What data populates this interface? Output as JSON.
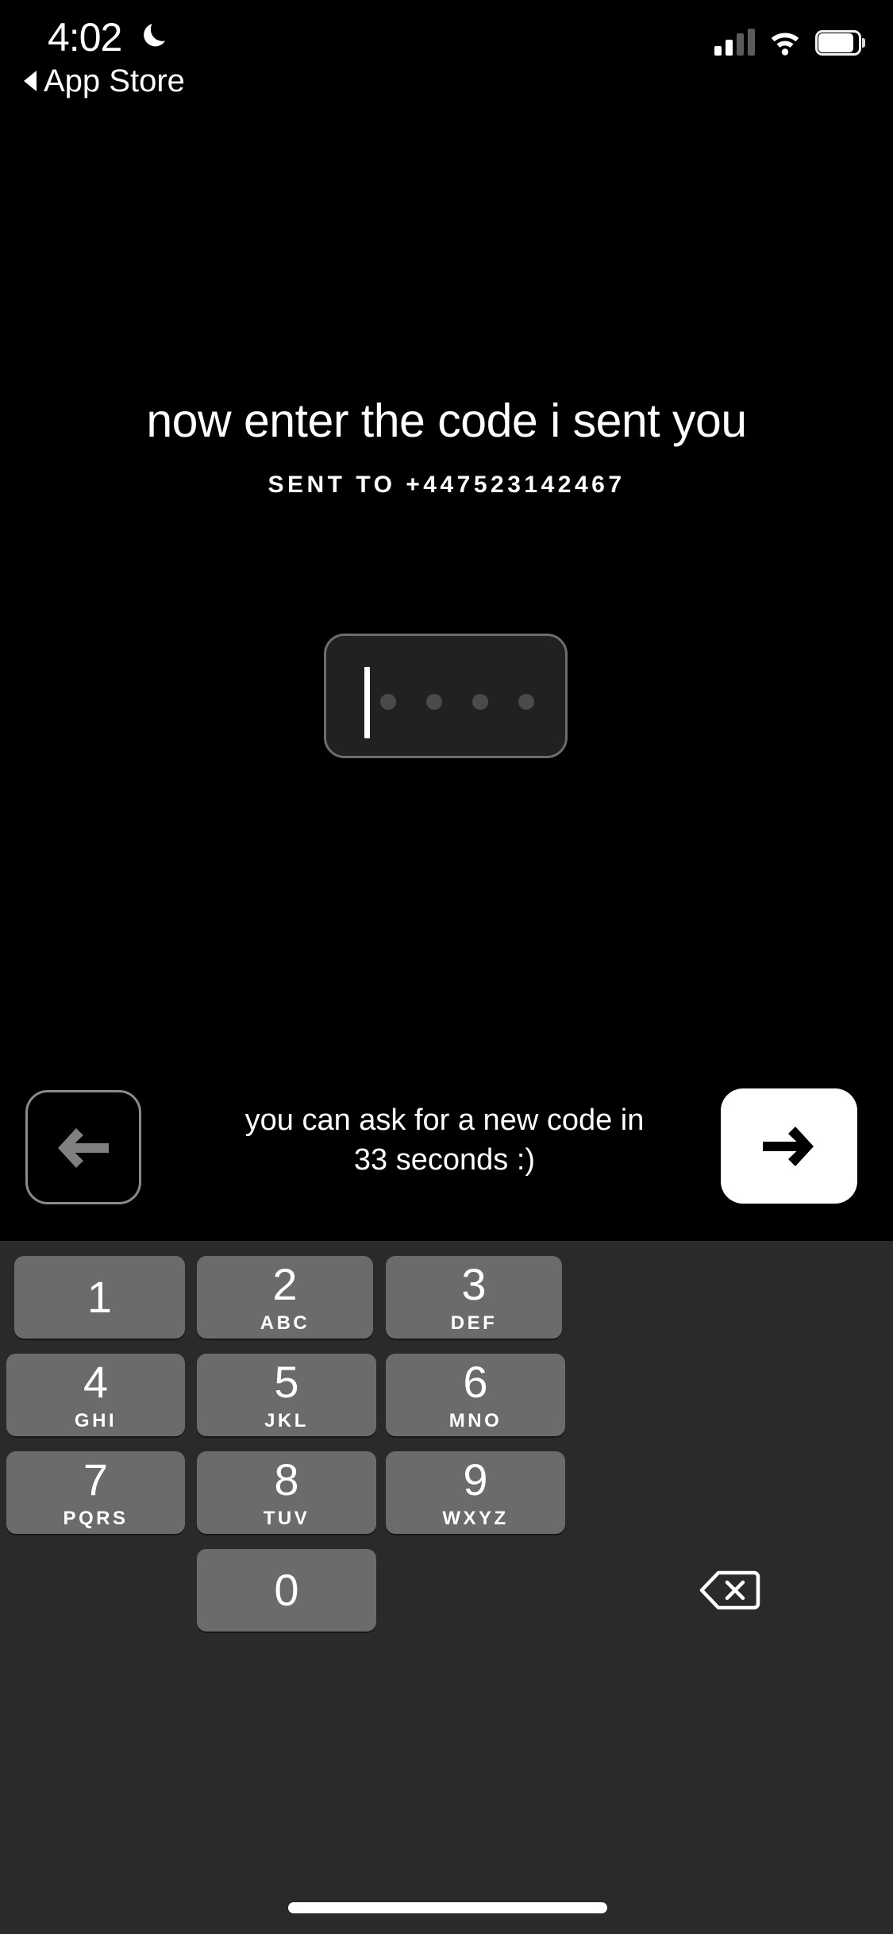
{
  "status_bar": {
    "time": "4:02",
    "dnd_icon": "crescent-moon-icon",
    "back_label": "App Store",
    "back_icon": "back-triangle-icon",
    "signal_icon": "cellular-signal-icon",
    "wifi_icon": "wifi-icon",
    "battery_icon": "battery-icon"
  },
  "main": {
    "headline": "now enter the code i sent you",
    "subtitle": "SENT TO +447523142467",
    "code_input": {
      "value": "",
      "digit_count": 4,
      "cursor_visible": true,
      "dot_color": "#4a4a4a",
      "border_color": "#6d6d6d",
      "fill_color": "#212121"
    }
  },
  "actions": {
    "back_label": "",
    "back_icon": "arrow-left-icon",
    "resend_text": "you can ask for a new code in 33 seconds :)",
    "resend_seconds": "33",
    "next_label": "",
    "next_icon": "arrow-right-icon",
    "next_bg": "#ffffff"
  },
  "keypad": {
    "background": "#2a2a2a",
    "key_color": "#6b6b6b",
    "keys": [
      {
        "digit": "1",
        "letters": ""
      },
      {
        "digit": "2",
        "letters": "ABC"
      },
      {
        "digit": "3",
        "letters": "DEF"
      },
      {
        "digit": "4",
        "letters": "GHI"
      },
      {
        "digit": "5",
        "letters": "JKL"
      },
      {
        "digit": "6",
        "letters": "MNO"
      },
      {
        "digit": "7",
        "letters": "PQRS"
      },
      {
        "digit": "8",
        "letters": "TUV"
      },
      {
        "digit": "9",
        "letters": "WXYZ"
      },
      {
        "digit": "0",
        "letters": ""
      }
    ],
    "delete_icon": "backspace-delete-icon"
  },
  "home_indicator": "home-indicator"
}
